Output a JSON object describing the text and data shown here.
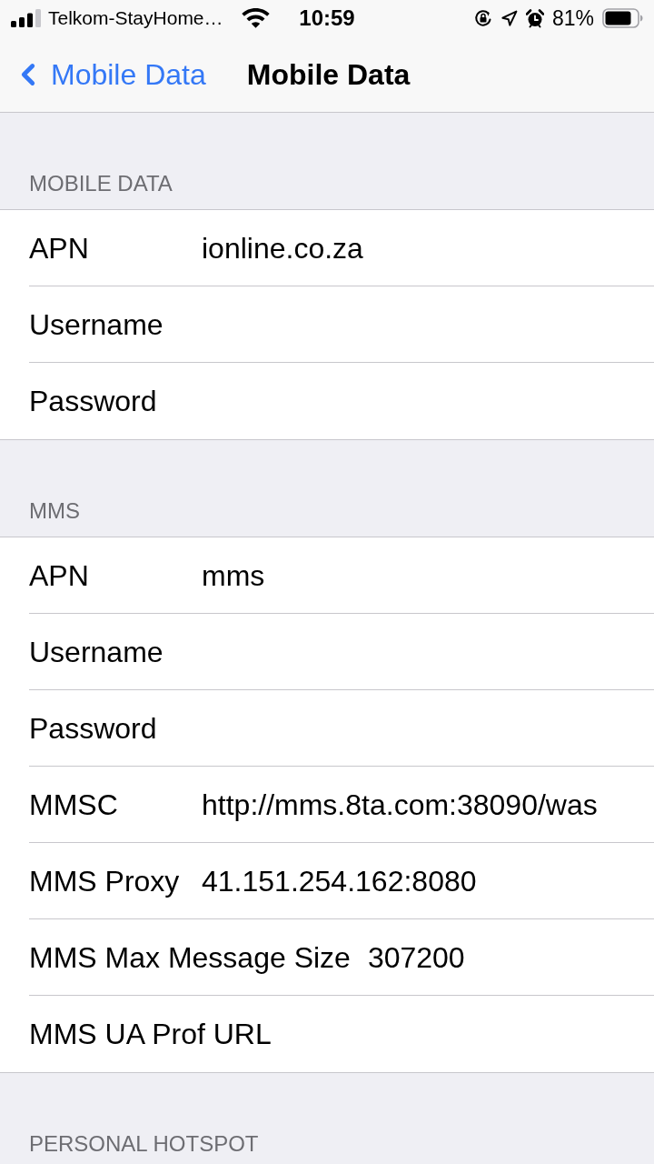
{
  "status_bar": {
    "carrier": "Telkom-StayHome…",
    "time": "10:59",
    "battery": "81%"
  },
  "nav": {
    "back": "Mobile Data",
    "title": "Mobile Data"
  },
  "sections": [
    {
      "header": "MOBILE DATA",
      "rows": [
        {
          "label": "APN",
          "value": "ionline.co.za"
        },
        {
          "label": "Username"
        },
        {
          "label": "Password"
        }
      ]
    },
    {
      "header": "MMS",
      "rows": [
        {
          "label": "APN",
          "value": "mms"
        },
        {
          "label": "Username"
        },
        {
          "label": "Password"
        },
        {
          "label": "MMSC",
          "value": "http://mms.8ta.com:38090/was"
        },
        {
          "label": "MMS Proxy",
          "value": "41.151.254.162:8080"
        },
        {
          "label": "MMS Max Message Size",
          "value": "307200"
        },
        {
          "label": "MMS UA Prof URL"
        }
      ]
    },
    {
      "header": "PERSONAL HOTSPOT"
    }
  ]
}
